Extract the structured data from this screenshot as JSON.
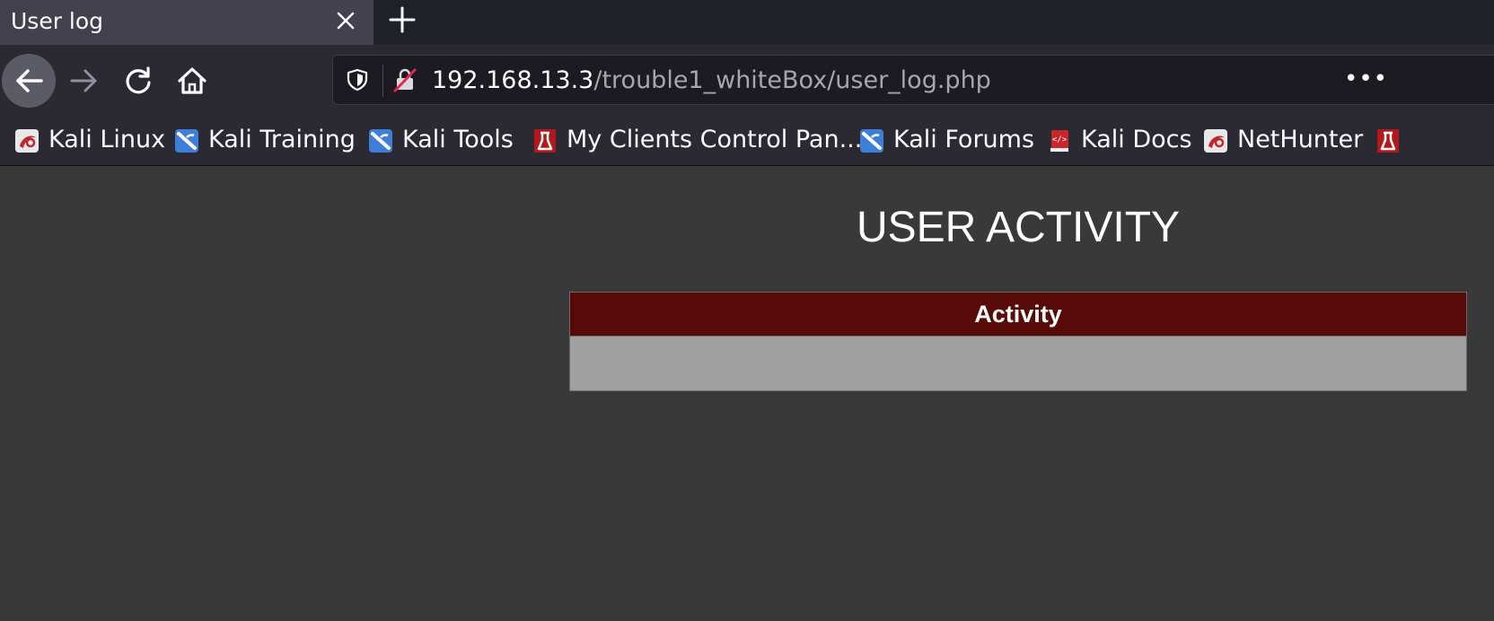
{
  "tab": {
    "title": "User log"
  },
  "url": {
    "host": "192.168.13.3",
    "path": "/trouble1_whiteBox/user_log.php"
  },
  "bookmarks": [
    {
      "label": "Kali Linux",
      "icon": "kali-dragon-icon"
    },
    {
      "label": "Kali Training",
      "icon": "kali-training-icon"
    },
    {
      "label": "Kali Tools",
      "icon": "kali-tools-icon"
    },
    {
      "label": "My Clients Control Pan...",
      "icon": "flask-icon"
    },
    {
      "label": "Kali Forums",
      "icon": "kali-forums-icon"
    },
    {
      "label": "Kali Docs",
      "icon": "docs-book-icon"
    },
    {
      "label": "NetHunter",
      "icon": "nethunter-icon"
    }
  ],
  "page": {
    "heading": "USER ACTIVITY",
    "table": {
      "header": "Activity",
      "rows": [
        ""
      ]
    }
  },
  "colors": {
    "page_bg": "#393939",
    "table_header_bg": "#570a08",
    "table_row_bg": "#a0a0a0"
  }
}
